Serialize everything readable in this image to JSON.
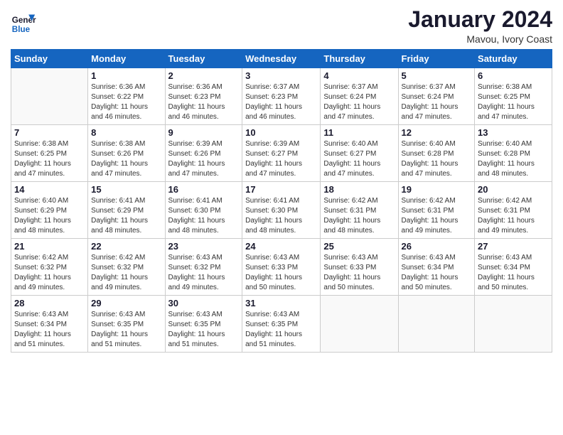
{
  "header": {
    "title": "January 2024",
    "location": "Mavou, Ivory Coast",
    "logo_line1": "General",
    "logo_line2": "Blue"
  },
  "days_of_week": [
    "Sunday",
    "Monday",
    "Tuesday",
    "Wednesday",
    "Thursday",
    "Friday",
    "Saturday"
  ],
  "weeks": [
    [
      {
        "day": "",
        "info": ""
      },
      {
        "day": "1",
        "info": "Sunrise: 6:36 AM\nSunset: 6:22 PM\nDaylight: 11 hours\nand 46 minutes."
      },
      {
        "day": "2",
        "info": "Sunrise: 6:36 AM\nSunset: 6:23 PM\nDaylight: 11 hours\nand 46 minutes."
      },
      {
        "day": "3",
        "info": "Sunrise: 6:37 AM\nSunset: 6:23 PM\nDaylight: 11 hours\nand 46 minutes."
      },
      {
        "day": "4",
        "info": "Sunrise: 6:37 AM\nSunset: 6:24 PM\nDaylight: 11 hours\nand 47 minutes."
      },
      {
        "day": "5",
        "info": "Sunrise: 6:37 AM\nSunset: 6:24 PM\nDaylight: 11 hours\nand 47 minutes."
      },
      {
        "day": "6",
        "info": "Sunrise: 6:38 AM\nSunset: 6:25 PM\nDaylight: 11 hours\nand 47 minutes."
      }
    ],
    [
      {
        "day": "7",
        "info": "Sunrise: 6:38 AM\nSunset: 6:25 PM\nDaylight: 11 hours\nand 47 minutes."
      },
      {
        "day": "8",
        "info": "Sunrise: 6:38 AM\nSunset: 6:26 PM\nDaylight: 11 hours\nand 47 minutes."
      },
      {
        "day": "9",
        "info": "Sunrise: 6:39 AM\nSunset: 6:26 PM\nDaylight: 11 hours\nand 47 minutes."
      },
      {
        "day": "10",
        "info": "Sunrise: 6:39 AM\nSunset: 6:27 PM\nDaylight: 11 hours\nand 47 minutes."
      },
      {
        "day": "11",
        "info": "Sunrise: 6:40 AM\nSunset: 6:27 PM\nDaylight: 11 hours\nand 47 minutes."
      },
      {
        "day": "12",
        "info": "Sunrise: 6:40 AM\nSunset: 6:28 PM\nDaylight: 11 hours\nand 47 minutes."
      },
      {
        "day": "13",
        "info": "Sunrise: 6:40 AM\nSunset: 6:28 PM\nDaylight: 11 hours\nand 48 minutes."
      }
    ],
    [
      {
        "day": "14",
        "info": "Sunrise: 6:40 AM\nSunset: 6:29 PM\nDaylight: 11 hours\nand 48 minutes."
      },
      {
        "day": "15",
        "info": "Sunrise: 6:41 AM\nSunset: 6:29 PM\nDaylight: 11 hours\nand 48 minutes."
      },
      {
        "day": "16",
        "info": "Sunrise: 6:41 AM\nSunset: 6:30 PM\nDaylight: 11 hours\nand 48 minutes."
      },
      {
        "day": "17",
        "info": "Sunrise: 6:41 AM\nSunset: 6:30 PM\nDaylight: 11 hours\nand 48 minutes."
      },
      {
        "day": "18",
        "info": "Sunrise: 6:42 AM\nSunset: 6:31 PM\nDaylight: 11 hours\nand 48 minutes."
      },
      {
        "day": "19",
        "info": "Sunrise: 6:42 AM\nSunset: 6:31 PM\nDaylight: 11 hours\nand 49 minutes."
      },
      {
        "day": "20",
        "info": "Sunrise: 6:42 AM\nSunset: 6:31 PM\nDaylight: 11 hours\nand 49 minutes."
      }
    ],
    [
      {
        "day": "21",
        "info": "Sunrise: 6:42 AM\nSunset: 6:32 PM\nDaylight: 11 hours\nand 49 minutes."
      },
      {
        "day": "22",
        "info": "Sunrise: 6:42 AM\nSunset: 6:32 PM\nDaylight: 11 hours\nand 49 minutes."
      },
      {
        "day": "23",
        "info": "Sunrise: 6:43 AM\nSunset: 6:32 PM\nDaylight: 11 hours\nand 49 minutes."
      },
      {
        "day": "24",
        "info": "Sunrise: 6:43 AM\nSunset: 6:33 PM\nDaylight: 11 hours\nand 50 minutes."
      },
      {
        "day": "25",
        "info": "Sunrise: 6:43 AM\nSunset: 6:33 PM\nDaylight: 11 hours\nand 50 minutes."
      },
      {
        "day": "26",
        "info": "Sunrise: 6:43 AM\nSunset: 6:34 PM\nDaylight: 11 hours\nand 50 minutes."
      },
      {
        "day": "27",
        "info": "Sunrise: 6:43 AM\nSunset: 6:34 PM\nDaylight: 11 hours\nand 50 minutes."
      }
    ],
    [
      {
        "day": "28",
        "info": "Sunrise: 6:43 AM\nSunset: 6:34 PM\nDaylight: 11 hours\nand 51 minutes."
      },
      {
        "day": "29",
        "info": "Sunrise: 6:43 AM\nSunset: 6:35 PM\nDaylight: 11 hours\nand 51 minutes."
      },
      {
        "day": "30",
        "info": "Sunrise: 6:43 AM\nSunset: 6:35 PM\nDaylight: 11 hours\nand 51 minutes."
      },
      {
        "day": "31",
        "info": "Sunrise: 6:43 AM\nSunset: 6:35 PM\nDaylight: 11 hours\nand 51 minutes."
      },
      {
        "day": "",
        "info": ""
      },
      {
        "day": "",
        "info": ""
      },
      {
        "day": "",
        "info": ""
      }
    ]
  ]
}
